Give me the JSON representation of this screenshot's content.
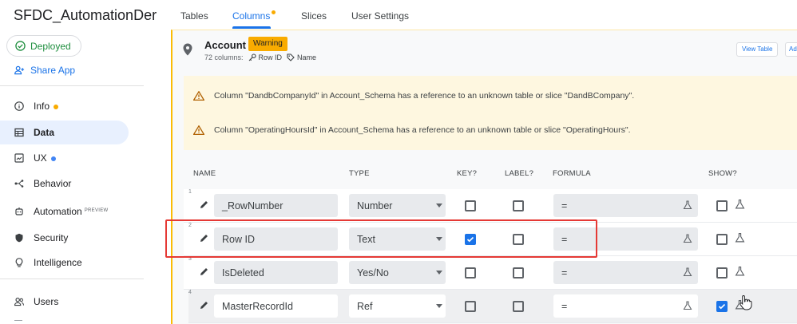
{
  "app": {
    "title": "SFDC_AutomationDer"
  },
  "sidebar": {
    "deployed_label": "Deployed",
    "share_label": "Share App",
    "items": [
      {
        "label": "Info",
        "icon": "info-icon",
        "dot": "#f9ab00"
      },
      {
        "label": "Data",
        "icon": "table-icon",
        "active": true
      },
      {
        "label": "UX",
        "icon": "ux-icon",
        "dot": "#4285f4"
      },
      {
        "label": "Behavior",
        "icon": "behavior-icon"
      },
      {
        "label": "Automation",
        "icon": "automation-icon",
        "badge": "PREVIEW"
      },
      {
        "label": "Security",
        "icon": "shield-icon"
      },
      {
        "label": "Intelligence",
        "icon": "lightbulb-icon"
      },
      {
        "label": "Users",
        "icon": "users-icon"
      }
    ]
  },
  "tabs": [
    {
      "label": "Tables"
    },
    {
      "label": "Columns",
      "active": true,
      "dot": "#f9ab00"
    },
    {
      "label": "Slices"
    },
    {
      "label": "User Settings"
    }
  ],
  "table": {
    "name": "Account",
    "badge": "Warning",
    "columns_count": "72 columns:",
    "key_label": "Row ID",
    "label_label": "Name",
    "view_table_button": "View Table",
    "add_button": "Ad"
  },
  "alerts": [
    "Column \"DandbCompanyId\" in Account_Schema has a reference to an unknown table or slice \"DandBCompany\".",
    "Column \"OperatingHoursId\" in Account_Schema has a reference to an unknown table or slice \"OperatingHours\"."
  ],
  "column_headers": {
    "name": "NAME",
    "type": "TYPE",
    "key": "KEY?",
    "label": "LABEL?",
    "formula": "FORMULA",
    "show": "SHOW?"
  },
  "rows": [
    {
      "num": "1",
      "name": "_RowNumber",
      "type": "Number",
      "key": false,
      "label": false,
      "formula": "=",
      "show": false
    },
    {
      "num": "2",
      "name": "Row ID",
      "type": "Text",
      "key": true,
      "label": false,
      "formula": "=",
      "show": false
    },
    {
      "num": "3",
      "name": "IsDeleted",
      "type": "Yes/No",
      "key": false,
      "label": false,
      "formula": "=",
      "show": false
    },
    {
      "num": "4",
      "name": "MasterRecordId",
      "type": "Ref",
      "key": false,
      "label": false,
      "formula": "=",
      "show": true
    }
  ],
  "colors": {
    "accent": "#1a73e8",
    "warning": "#f9ab00",
    "highlight": "#e53935"
  }
}
